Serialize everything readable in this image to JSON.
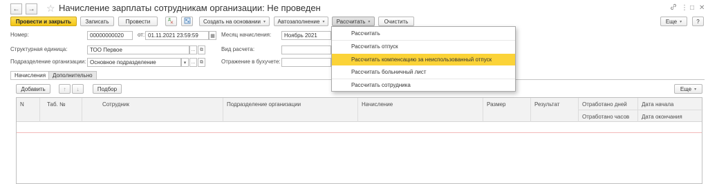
{
  "window": {
    "title": "Начисление зарплаты сотрудникам организации: Не проведен",
    "back_glyph": "←",
    "forward_glyph": "→",
    "star_glyph": "☆",
    "link_glyph": "🔗",
    "menu_glyph": "⋮",
    "restore_glyph": "□",
    "close_glyph": "✕"
  },
  "toolbar": {
    "post_close": "Провести и закрыть",
    "save": "Записать",
    "post": "Провести",
    "create_based": "Создать на основании",
    "autofill": "Автозаполнение",
    "calculate": "Рассчитать",
    "clear": "Очистить",
    "more": "Еще",
    "help": "?",
    "caret": "▾"
  },
  "form": {
    "number_label": "Номер:",
    "number_value": "00000000020",
    "date_label": "от:",
    "date_value": "01.11.2021 23:59:59",
    "month_label": "Месяц начисления:",
    "month_value": "Ноябрь 2021",
    "unit_label": "Структурная единица:",
    "unit_value": "ТОО Первое",
    "calc_type_label": "Вид расчета:",
    "calc_type_value": "",
    "department_label": "Подразделение организации:",
    "department_value": "Основное подразделение",
    "accounting_label": "Отражение в бухучете:",
    "accounting_value": "",
    "ellipsis": "...",
    "open_glyph": "⧉",
    "dropdown_glyph": "▾",
    "calendar_glyph": "▦"
  },
  "tabs": [
    {
      "label": "Начисления"
    },
    {
      "label": "Дополнительно"
    }
  ],
  "table_toolbar": {
    "add": "Добавить",
    "up_glyph": "↑",
    "down_glyph": "↓",
    "selection": "Подбор",
    "more": "Еще"
  },
  "table": {
    "columns": {
      "n": "N",
      "tab_no": "Таб. №",
      "employee": "Сотрудник",
      "department": "Подразделение организации",
      "accrual": "Начисление",
      "amount": "Размер",
      "result": "Результат",
      "days_worked": "Отработано дней",
      "hours_worked": "Отработано часов",
      "start_date": "Дата начала",
      "end_date": "Дата окончания"
    }
  },
  "calculate_menu": {
    "items": [
      "Рассчитать",
      "Рассчитать отпуск",
      "Рассчитать компенсацию за неиспользованный отпуск",
      "Рассчитать больничный лист",
      "Рассчитать сотрудника"
    ],
    "highlighted_index": 2
  },
  "colors": {
    "primary_button": "#f3c513",
    "menu_highlight": "#fbd338",
    "empty_row_line": "#f2b8b8"
  }
}
